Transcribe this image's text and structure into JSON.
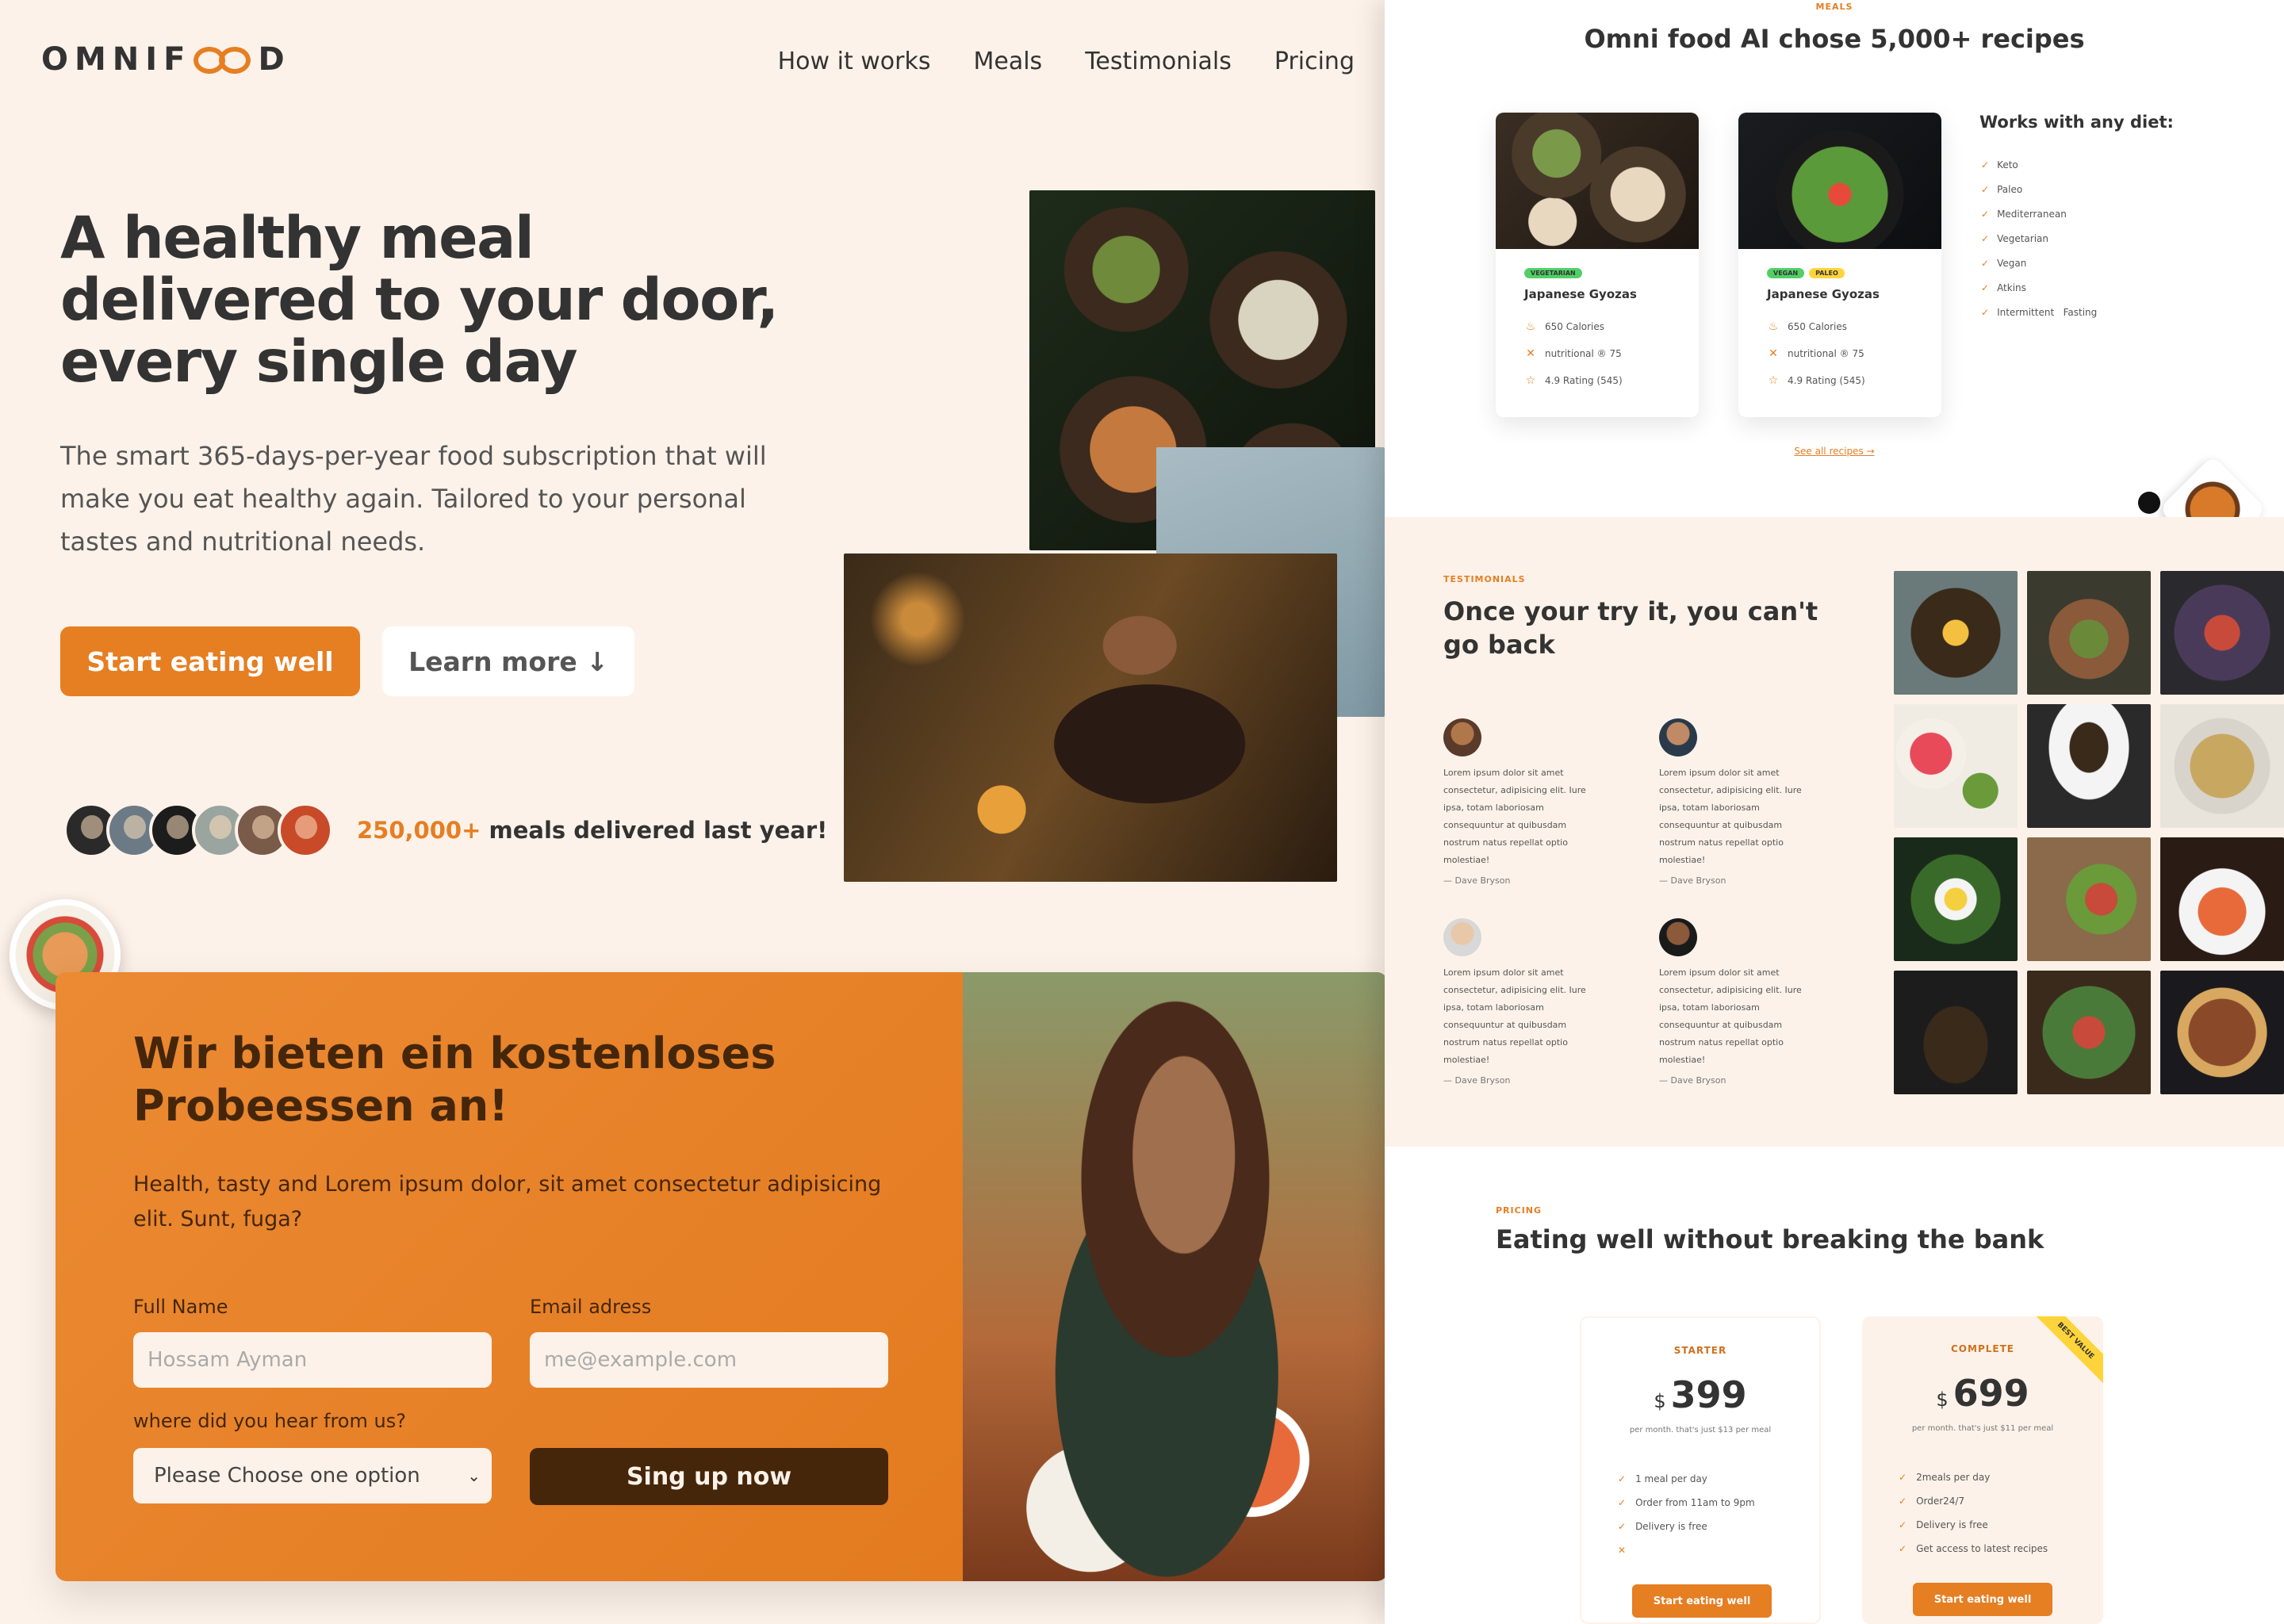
{
  "brand": {
    "name_prefix": "OMNIF",
    "name_suffix": "D",
    "accent": "#e67e22",
    "dark": "#45260a",
    "bg": "#fdf2e9"
  },
  "nav": {
    "items": [
      "How it works",
      "Meals",
      "Testimonials",
      "Pricing"
    ]
  },
  "hero": {
    "title": "A healthy meal delivered to your door, every single day",
    "description": "The smart 365-days-per-year food subscription that will make you eat healthy again. Tailored to your personal tastes and nutritional needs.",
    "primary_button": "Start eating well",
    "secondary_button": "Learn more ↓",
    "delivered_count": "250,000+",
    "delivered_text": "meals delivered last year!"
  },
  "cta": {
    "title": "Wir bieten ein kostenloses Probeessen an!",
    "text": "Health, tasty and Lorem ipsum dolor, sit amet consectetur adipisicing elit. Sunt, fuga?",
    "name_label": "Full Name",
    "name_placeholder": "Hossam Ayman",
    "email_label": "Email adress",
    "email_placeholder": "me@example.com",
    "source_label": "where did you hear from us?",
    "source_selected": "Please Choose one option",
    "submit": "Sing up now"
  },
  "meals": {
    "subheading": "MEALS",
    "heading": "Omni food AI chose 5,000+ recipes",
    "cards": [
      {
        "tags": [
          "VEGETARIAN"
        ],
        "title": "Japanese Gyozas",
        "calories": "650 Calories",
        "nutri": "nutritional ® 75",
        "rating": "4.9 Rating (545)"
      },
      {
        "tags": [
          "VEGAN",
          "PALEO"
        ],
        "title": "Japanese Gyozas",
        "calories": "650 Calories",
        "nutri": "nutritional ® 75",
        "rating": "4.9 Rating (545)"
      }
    ],
    "diet_title": "Works with any diet:",
    "diets": [
      "Keto",
      "Paleo",
      "Mediterranean",
      "Vegetarian",
      "Vegan",
      "Atkins",
      "Intermittent   Fasting"
    ],
    "see_all": "See all recipes →"
  },
  "testimonials": {
    "subheading": "TESTIMONIALS",
    "heading": "Once your try it, you can't go back",
    "items": [
      {
        "quote": "Lorem ipsum dolor sit amet consectetur, adipisicing elit. Iure ipsa, totam laboriosam consequuntur at quibusdam nostrum natus repellat optio molestiae!",
        "name": "— Dave Bryson"
      },
      {
        "quote": "Lorem ipsum dolor sit amet consectetur, adipisicing elit. Iure ipsa, totam laboriosam consequuntur at quibusdam nostrum natus repellat optio molestiae!",
        "name": "— Dave Bryson"
      },
      {
        "quote": "Lorem ipsum dolor sit amet consectetur, adipisicing elit. Iure ipsa, totam laboriosam consequuntur at quibusdam nostrum natus repellat optio molestiae!",
        "name": "— Dave Bryson"
      },
      {
        "quote": "Lorem ipsum dolor sit amet consectetur, adipisicing elit. Iure ipsa, totam laboriosam consequuntur at quibusdam nostrum natus repellat optio molestiae!",
        "name": "— Dave Bryson"
      }
    ]
  },
  "pricing": {
    "subheading": "PRICING",
    "heading": "Eating well without breaking the bank",
    "plans": [
      {
        "name": "STARTER",
        "currency": "$",
        "price": "399",
        "per": "per month. that's just $13 per meal",
        "features": [
          "1 meal per day",
          "Order from 11am to 9pm",
          "Delivery is free",
          ""
        ],
        "button": "Start eating well"
      },
      {
        "name": "COMPLETE",
        "currency": "$",
        "price": "699",
        "per": "per month. that's just $11 per meal",
        "features": [
          "2meals per day",
          "Order24/7",
          "Delivery is free",
          "Get access to latest recipes"
        ],
        "button": "Start eating well",
        "badge": "BEST VALUE"
      }
    ]
  }
}
